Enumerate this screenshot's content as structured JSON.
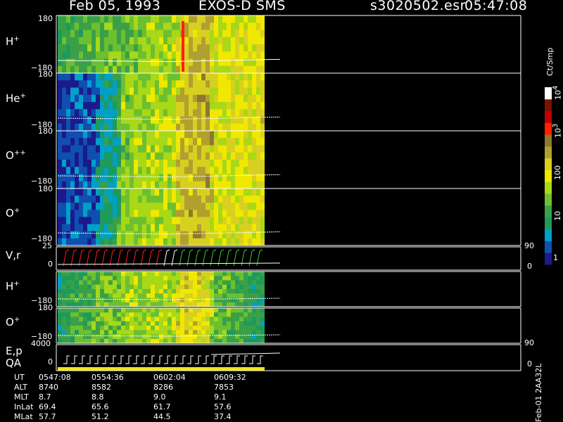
{
  "header": {
    "date": "Feb 05, 1993",
    "mission": "EXOS-D SMS",
    "file": "s3020502.esr",
    "time": "05:47:08"
  },
  "colorbar": {
    "unit_label": "Ct/Smp",
    "scale": "log",
    "range": [
      1,
      10000
    ],
    "tick_labels": [
      "1",
      "10",
      "100",
      "10",
      "10"
    ],
    "tick_exponents": [
      "",
      "",
      "",
      "3",
      "4"
    ],
    "colors": [
      "#1a1a8c",
      "#0f4fb0",
      "#00a0c8",
      "#1e9a5a",
      "#3aa048",
      "#6cc030",
      "#a8d818",
      "#f0e800",
      "#d8d020",
      "#b0a030",
      "#8c7830",
      "#ff2000",
      "#c00000",
      "#801000",
      "#ffffff"
    ]
  },
  "side_label": "Feb-01 2AA32L",
  "chart_data": [
    {
      "type": "heatmap",
      "panel": "H+",
      "label": "H",
      "sup": "+",
      "ylim": [
        -180,
        180
      ],
      "ytick_top": "180",
      "ytick_bottom": "−180"
    },
    {
      "type": "heatmap",
      "panel": "He+",
      "label": "He",
      "sup": "+",
      "ylim": [
        -180,
        180
      ],
      "ytick_top": "180",
      "ytick_bottom": "−180"
    },
    {
      "type": "heatmap",
      "panel": "O++",
      "label": "O",
      "sup": "++",
      "ylim": [
        -180,
        180
      ],
      "ytick_top": "180",
      "ytick_bottom": "−180"
    },
    {
      "type": "heatmap",
      "panel": "O+",
      "label": "O",
      "sup": "+",
      "ylim": [
        -180,
        180
      ],
      "ytick_top": "180",
      "ytick_bottom": "−180"
    },
    {
      "type": "line",
      "panel": "V,r",
      "label": "V,r",
      "ylim": [
        0,
        25
      ],
      "ytick_top": "25",
      "ytick_bottom": "0",
      "right_ticks": [
        "90",
        "0"
      ]
    },
    {
      "type": "heatmap",
      "panel": "H+ (2)",
      "label": "H",
      "sup": "+",
      "ylim": [
        -180,
        180
      ],
      "ytick_bottom": "−180"
    },
    {
      "type": "heatmap",
      "panel": "O+ (2)",
      "label": "O",
      "sup": "+",
      "ylim": [
        -180,
        180
      ],
      "ytick_top": "180",
      "ytick_bottom": "−180"
    },
    {
      "type": "line",
      "panel": "E,p",
      "label": "E,p",
      "label2": "QA",
      "ylim": [
        0,
        4000
      ],
      "ytick_top": "4000",
      "ytick_bottom": "0",
      "right_ticks": [
        "90",
        "0"
      ]
    }
  ],
  "ephemeris": {
    "rows": [
      {
        "name": "UT",
        "values": [
          "0547:08",
          "0554:36",
          "0602:04",
          "0609:32"
        ]
      },
      {
        "name": "ALT",
        "values": [
          "8740",
          "8582",
          "8286",
          "7853"
        ]
      },
      {
        "name": "MLT",
        "values": [
          "8.7",
          "8.8",
          "9.0",
          "9.1"
        ]
      },
      {
        "name": "InLat",
        "values": [
          "69.4",
          "65.6",
          "61.7",
          "57.6"
        ]
      },
      {
        "name": "MLat",
        "values": [
          "57.7",
          "51.2",
          "44.5",
          "37.4"
        ]
      }
    ]
  }
}
